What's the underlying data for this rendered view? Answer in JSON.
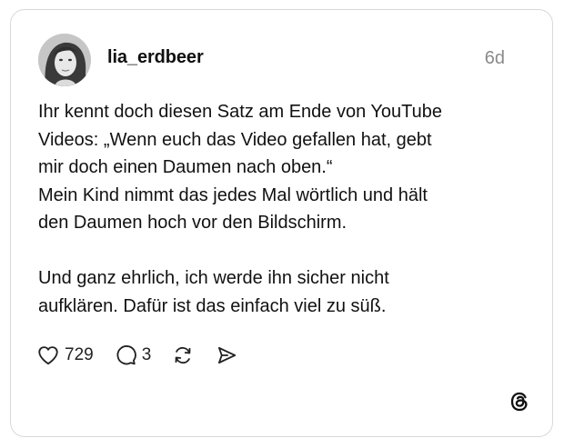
{
  "post": {
    "author": {
      "username": "lia_erdbeer",
      "avatar_icon": "profile-photo"
    },
    "timestamp": "6d",
    "text": "Ihr kennt doch diesen Satz am Ende von YouTube\nVideos: „Wenn euch das Video gefallen hat, gebt\nmir doch einen Daumen nach oben.“\nMein Kind nimmt das jedes Mal wörtlich und hält\nden Daumen hoch vor den Bildschirm.\n\nUnd ganz ehrlich, ich werde ihn sicher nicht\naufklären. Dafür ist das einfach viel zu süß.",
    "actions": {
      "likes": "729",
      "replies": "3",
      "like_icon": "heart-icon",
      "reply_icon": "comment-icon",
      "repost_icon": "repost-icon",
      "share_icon": "send-icon"
    },
    "brand_icon": "threads-logo-icon"
  }
}
